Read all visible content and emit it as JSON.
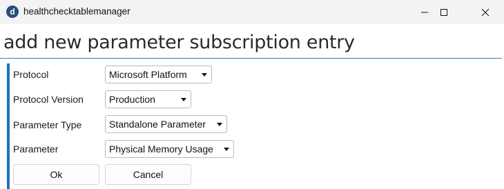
{
  "window": {
    "title": "healthchecktablemanager",
    "app_icon_letter": "d",
    "icons": [
      "minimize-icon",
      "maximize-icon",
      "close-icon"
    ]
  },
  "page": {
    "title": "add new parameter subscription entry"
  },
  "form": {
    "fields": [
      {
        "label": "Protocol",
        "value": "Microsoft Platform"
      },
      {
        "label": "Protocol Version",
        "value": "Production"
      },
      {
        "label": "Parameter Type",
        "value": "Standalone Parameter"
      },
      {
        "label": "Parameter",
        "value": "Physical Memory Usage"
      }
    ],
    "ok_label": "Ok",
    "cancel_label": "Cancel"
  },
  "colors": {
    "accent": "#1e6fc4",
    "title_rule": "#3a7bbf",
    "titlebar_bg": "#f3f3f3"
  }
}
